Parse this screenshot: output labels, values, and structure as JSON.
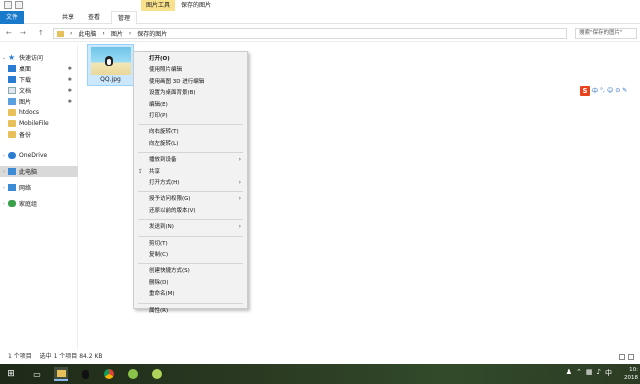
{
  "titlebar": {
    "context_tab": "图片工具",
    "window_title": "保存的图片"
  },
  "ribbon": {
    "tabs": [
      "文件",
      "共享",
      "查看",
      "管理"
    ]
  },
  "address": {
    "back_icon": "←",
    "forward_icon": "→",
    "up_icon": "↑",
    "path": [
      "此电脑",
      "图片",
      "保存的图片"
    ],
    "separator": "›",
    "search_placeholder": "搜索\"保存的图片\""
  },
  "nav": {
    "items": [
      {
        "label": "快速访问",
        "icon": "star-icon"
      },
      {
        "label": "桌面",
        "icon": "desktop-icon",
        "pinned": true
      },
      {
        "label": "下载",
        "icon": "download-icon",
        "pinned": true
      },
      {
        "label": "文档",
        "icon": "document-icon",
        "pinned": true
      },
      {
        "label": "图片",
        "icon": "pictures-icon",
        "pinned": true
      },
      {
        "label": "htdocs",
        "icon": "folder-icon"
      },
      {
        "label": "MobileFile",
        "icon": "folder-icon"
      },
      {
        "label": "备份",
        "icon": "folder-icon"
      },
      {
        "label": "OneDrive",
        "icon": "cloud-icon"
      },
      {
        "label": "此电脑",
        "icon": "computer-icon",
        "selected": true
      },
      {
        "label": "网络",
        "icon": "network-icon"
      },
      {
        "label": "家庭组",
        "icon": "homegroup-icon"
      }
    ],
    "pin_glyph": "✱"
  },
  "file": {
    "name": "QQ.jpg"
  },
  "ime": {
    "logo": "S",
    "items": [
      "中",
      "°,",
      "☺",
      "⊙",
      "✎"
    ]
  },
  "context_menu": {
    "groups": [
      [
        {
          "label": "打开(O)",
          "bold": true
        },
        {
          "label": "使用照片编辑"
        },
        {
          "label": "使用画图 3D 进行编辑"
        },
        {
          "label": "设置为桌面背景(B)"
        },
        {
          "label": "编辑(E)"
        },
        {
          "label": "打印(P)"
        }
      ],
      [
        {
          "label": "向右旋转(T)"
        },
        {
          "label": "向左旋转(L)"
        }
      ],
      [
        {
          "label": "播放到设备",
          "submenu": true
        },
        {
          "label": "共享",
          "icon": "share-icon"
        },
        {
          "label": "打开方式(H)",
          "submenu": true
        }
      ],
      [
        {
          "label": "授予访问权限(G)",
          "submenu": true
        },
        {
          "label": "还原以前的版本(V)"
        }
      ],
      [
        {
          "label": "发送到(N)",
          "submenu": true
        }
      ],
      [
        {
          "label": "剪切(T)"
        },
        {
          "label": "复制(C)"
        }
      ],
      [
        {
          "label": "创建快捷方式(S)"
        },
        {
          "label": "删除(D)"
        },
        {
          "label": "重命名(M)"
        }
      ],
      [
        {
          "label": "属性(R)"
        }
      ]
    ],
    "submenu_glyph": "›"
  },
  "status": {
    "count": "1 个项目",
    "selection": "选中 1 个项目 84.2 KB"
  },
  "taskbar": {
    "start_icon": "windows-icon",
    "clock_time": "10:",
    "clock_date": "2018"
  }
}
